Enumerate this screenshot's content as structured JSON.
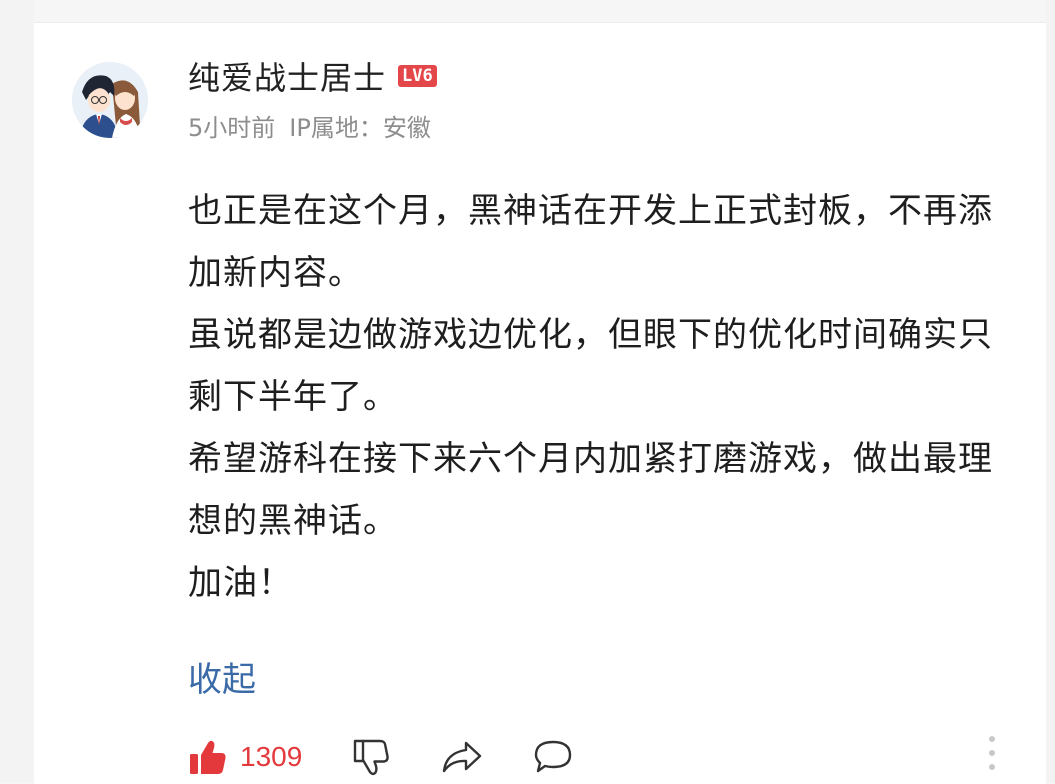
{
  "comment": {
    "username": "纯爱战士居士",
    "level_badge": "LV6",
    "time_ago": "5小时前",
    "ip_location": "IP属地：安徽",
    "paragraphs": [
      "也正是在这个月，黑神话在开发上正式封板，不再添加新内容。",
      "虽说都是边做游戏边优化，但眼下的优化时间确实只剩下半年了。",
      "希望游科在接下来六个月内加紧打磨游戏，做出最理想的黑神话。",
      "加油！"
    ],
    "collapse_label": "收起"
  },
  "actions": {
    "like_count": "1309",
    "icons": [
      "thumbs-up-icon",
      "thumbs-down-icon",
      "share-icon",
      "reply-icon",
      "more-vertical-icon"
    ]
  },
  "colors": {
    "accent_red": "#e4393c",
    "link_blue": "#3b6aa8",
    "meta_gray": "#8d8d8d",
    "badge_red": "#e3474a"
  }
}
